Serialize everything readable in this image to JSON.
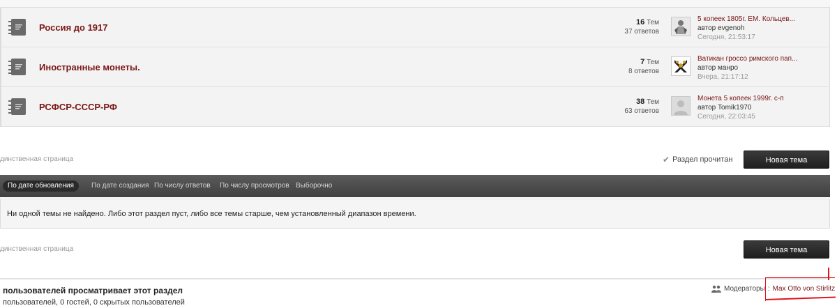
{
  "forums": [
    {
      "title": "Россия до 1917",
      "topics_count": "16",
      "topics_label": "Тем",
      "replies": "37 ответов",
      "last_post_title": "5 копеек 1805г. ЕМ. Кольцев...",
      "last_post_author": "автор evgenoh",
      "last_post_time": "Сегодня, 21:53:17"
    },
    {
      "title": "Иностранные монеты.",
      "topics_count": "7",
      "topics_label": "Тем",
      "replies": "8 ответов",
      "last_post_title": "Ватикан гроссо римского пап...",
      "last_post_author": "автор манро",
      "last_post_time": "Вчера, 21:17:12"
    },
    {
      "title": "РСФСР-СССР-РФ",
      "topics_count": "38",
      "topics_label": "Тем",
      "replies": "63 ответов",
      "last_post_title": "Монета 5 копеек 1999г. с-п",
      "last_post_author": "автор Tomik1970",
      "last_post_time": "Сегодня, 22:03:45"
    }
  ],
  "pagination": {
    "single_page_top": "динственная страница",
    "single_page_bottom": "динственная страница"
  },
  "actions": {
    "mark_read": "Раздел прочитан",
    "new_topic_top": "Новая тема",
    "new_topic_bottom": "Новая тема"
  },
  "sort_tabs": [
    "По дате обновления",
    "По дате создания",
    "По числу ответов",
    "По числу просмотров",
    "Выборочно"
  ],
  "empty_message": "Ни одной темы не найдено. Либо этот раздел пуст, либо все темы старше, чем установленный диапазон времени.",
  "viewers": {
    "title": "пользователей просматривает этот раздел",
    "subtitle": "пользователей, 0 гостей, 0 скрытых пользователей"
  },
  "moderators": {
    "label": "Модераторы",
    "name": "Max Otto von Stirlitz"
  },
  "colors": {
    "forum_link": "#7a1515",
    "annotation": "#e0151b"
  }
}
